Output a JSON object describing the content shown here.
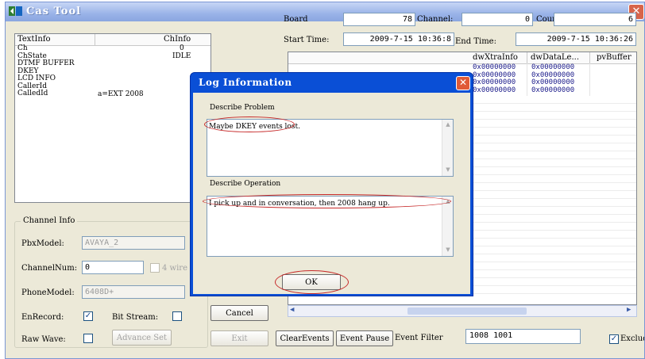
{
  "window": {
    "title": "Cas Tool",
    "close_glyph": "✕"
  },
  "info_table": {
    "headers": [
      "TextInfo",
      "ChInfo"
    ],
    "rows": [
      {
        "label": "Ch",
        "value": "0"
      },
      {
        "label": "ChState",
        "value": "IDLE"
      },
      {
        "label": "DTMF BUFFER",
        "value": ""
      },
      {
        "label": "DKEY",
        "value": ""
      },
      {
        "label": "LCD INFO",
        "value": ""
      },
      {
        "label": "CallerId",
        "value": ""
      },
      {
        "label": "CalledId",
        "value": "a=EXT 2008"
      }
    ]
  },
  "top_fields": {
    "board_label": "Board",
    "board_value": "78",
    "channel_label": "Channel:",
    "channel_value": "0",
    "counts_label": "Counts:",
    "counts_value": "6",
    "start_time_label": "Start Time:",
    "start_time_value": "2009-7-15 10:36:8",
    "end_time_label": "End Time:",
    "end_time_value": "2009-7-15 10:36:26"
  },
  "event_table": {
    "headers": [
      "dwXtraInfo",
      "dwDataLe...",
      "pvBuffer"
    ],
    "rows": [
      [
        "0x00000000",
        "0x00000000",
        ""
      ],
      [
        "0x00000000",
        "0x00000000",
        ""
      ],
      [
        "0x00000000",
        "0x00000000",
        ""
      ],
      [
        "0x00000000",
        "0x00000000",
        ""
      ]
    ]
  },
  "channel_info": {
    "group_label": "Channel Info",
    "pbx_model_label": "PbxModel:",
    "pbx_model_value": "AVAYA_2",
    "channel_num_label": "ChannelNum:",
    "channel_num_value": "0",
    "four_wire_label": "4 wire",
    "phone_model_label": "PhoneModel:",
    "phone_model_value": "6408D+",
    "en_record_label": "EnRecord:",
    "en_record_checked": true,
    "bit_stream_label": "Bit Stream:",
    "bit_stream_checked": false,
    "raw_wave_label": "Raw Wave:",
    "raw_wave_checked": false,
    "advance_set_label": "Advance Set"
  },
  "bottom_bar": {
    "cancel_label": "Cancel",
    "exit_label": "Exit",
    "clear_events_label": "ClearEvents",
    "event_pause_label": "Event Pause",
    "event_filter_label": "Event Filter",
    "event_filter_value": "1008 1001",
    "exclude_label": "Exclude",
    "exclude_checked": true
  },
  "dialog": {
    "title": "Log Information",
    "close_glyph": "✕",
    "describe_problem_label": "Describe Problem",
    "problem_text": "Maybe DKEY events lost.",
    "describe_operation_label": "Describe Operation",
    "operation_text": "I pick up and in conversation, then 2008 hang up.",
    "ok_label": "OK"
  },
  "colors": {
    "dialog_frame": "#0a4fd6",
    "window_bg": "#ece9d8",
    "annotation_red": "#c62828"
  }
}
